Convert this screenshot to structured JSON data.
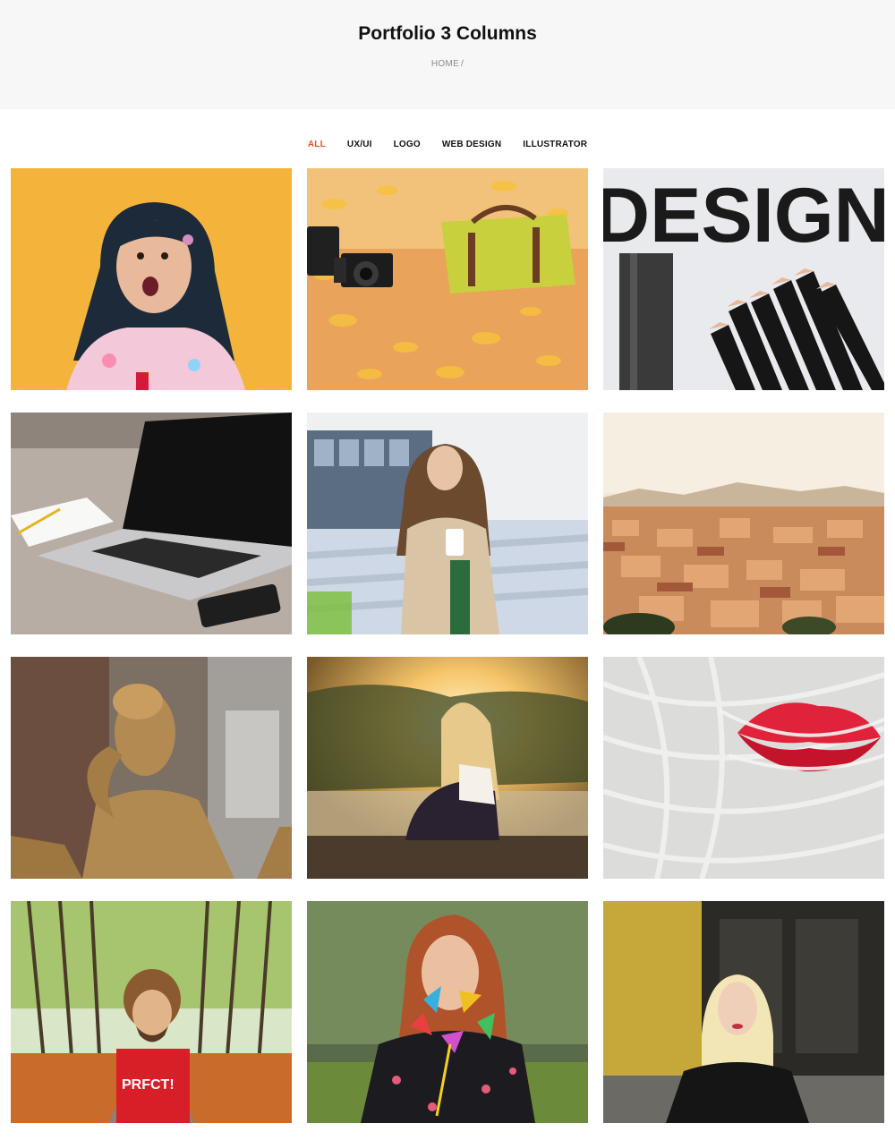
{
  "header": {
    "title": "Portfolio 3 Columns",
    "breadcrumb_home": "HOME",
    "breadcrumb_sep": "/"
  },
  "filters": [
    "ALL",
    "UX/UI",
    "LOGO",
    "WEB DESIGN",
    "ILLUSTRATOR"
  ],
  "active_filter": "ALL",
  "accent_color": "#e8521e",
  "tiles": [
    {
      "subject": "girl-yellow-background"
    },
    {
      "subject": "autumn-camera-bag"
    },
    {
      "subject": "design-pencils",
      "overlay_text": "DESIGN"
    },
    {
      "subject": "laptop-desk"
    },
    {
      "subject": "woman-phone-stairs"
    },
    {
      "subject": "city-sunset"
    },
    {
      "subject": "golden-statue-man"
    },
    {
      "subject": "woman-sunset-lake"
    },
    {
      "subject": "red-lips-white-hair"
    },
    {
      "subject": "man-forest-road",
      "shirt_text": "PRFCT!"
    },
    {
      "subject": "redhead-pinwheels"
    },
    {
      "subject": "blonde-leather-jacket"
    }
  ]
}
